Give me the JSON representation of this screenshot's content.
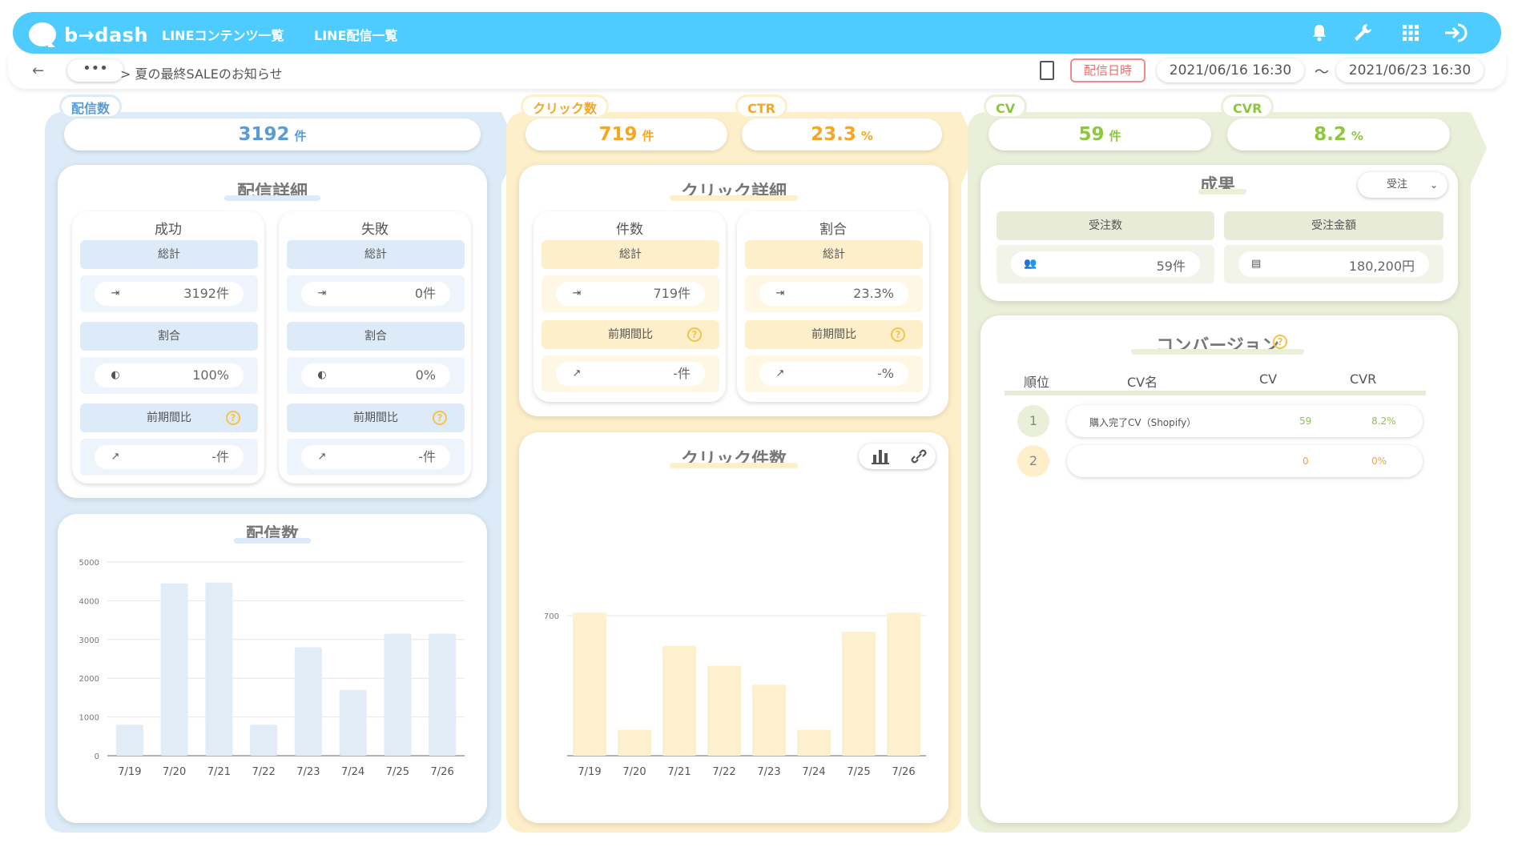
{
  "app": {
    "logo_text": "b→dash",
    "nav": [
      "LINEコンテンツ一覧",
      "LINE配信一覧"
    ]
  },
  "subheader": {
    "back": "←",
    "dots": "•••",
    "breadcrumb": "> 夏の最終SALEのお知らせ",
    "date_tag": "配信日時",
    "date_from": "2021/06/16 16:30",
    "tilde": "〜",
    "date_to": "2021/06/23 16:30"
  },
  "metrics": {
    "delivery": {
      "label": "配信数",
      "value": "3192",
      "unit": "件"
    },
    "clicks": {
      "label": "クリック数",
      "value": "719",
      "unit": "件"
    },
    "ctr": {
      "label": "CTR",
      "value": "23.3",
      "unit": "%"
    },
    "cv": {
      "label": "CV",
      "value": "59",
      "unit": "件"
    },
    "cvr": {
      "label": "CVR",
      "value": "8.2",
      "unit": "%"
    }
  },
  "delivery_detail": {
    "title": "配信詳細",
    "success": {
      "title": "成功",
      "total_label": "総計",
      "total": "3192件",
      "ratio_label": "割合",
      "ratio": "100%",
      "prev_label": "前期間比",
      "prev": "-件"
    },
    "failure": {
      "title": "失敗",
      "total_label": "総計",
      "total": "0件",
      "ratio_label": "割合",
      "ratio": "0%",
      "prev_label": "前期間比",
      "prev": "-件"
    }
  },
  "click_detail": {
    "title": "クリック詳細",
    "count": {
      "title": "件数",
      "total_label": "総計",
      "total": "719件",
      "prev_label": "前期間比",
      "prev": "-件"
    },
    "ratio": {
      "title": "割合",
      "total_label": "総計",
      "total": "23.3%",
      "prev_label": "前期間比",
      "prev": "-%"
    }
  },
  "results": {
    "title": "成果",
    "select": "受注",
    "orders_label": "受注数",
    "orders": "59件",
    "amount_label": "受注金額",
    "amount": "180,200円"
  },
  "conversion": {
    "title": "コンバージョン",
    "headers": [
      "順位",
      "CV名",
      "CV",
      "CVR"
    ],
    "rows": [
      {
        "rank": "1",
        "name": "購入完了CV（Shopify）",
        "cv": "59",
        "cvr": "8.2%"
      },
      {
        "rank": "2",
        "name": "",
        "cv": "0",
        "cvr": "0%"
      }
    ]
  },
  "help_icon": "?",
  "colors": {
    "header": "#4ecbff",
    "blue": "#5b9bd5",
    "orange": "#f5a623",
    "green": "#8dc63f"
  },
  "chart_data": [
    {
      "type": "bar",
      "title": "配信数",
      "categories": [
        "7/19",
        "7/20",
        "7/21",
        "7/22",
        "7/23",
        "7/24",
        "7/25",
        "7/26"
      ],
      "values": [
        800,
        4450,
        4470,
        800,
        2800,
        1700,
        3150,
        3150
      ],
      "yticks": [
        "0",
        "1000",
        "2000",
        "3000",
        "4000",
        "5000"
      ],
      "ylim": [
        0,
        5000
      ],
      "color": "#e1ecf7"
    },
    {
      "type": "bar",
      "title": "クリック件数",
      "categories": [
        "7/19",
        "7/20",
        "7/21",
        "7/22",
        "7/23",
        "7/24",
        "7/25",
        "7/26"
      ],
      "values": [
        715,
        130,
        550,
        450,
        355,
        130,
        620,
        715
      ],
      "yticks": [
        "700"
      ],
      "ylim": [
        0,
        700
      ],
      "color": "#fdf0cc"
    }
  ]
}
